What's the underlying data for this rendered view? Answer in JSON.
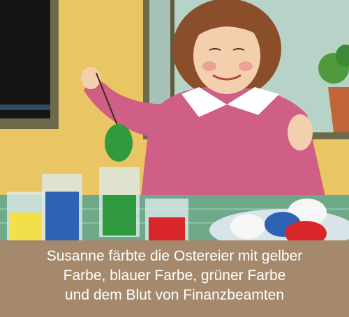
{
  "illustration": {
    "subject": "girl-dyeing-easter-eggs",
    "colors": {
      "wall": "#e9c563",
      "window_frame": "#6b6a4a",
      "window_dark": "#151515",
      "dress": "#cf5f86",
      "hair": "#8a4f2a",
      "skin": "#f4cfae",
      "collar": "#ffffff",
      "table": "#6ea98a",
      "yellow_dye": "#f2e04a",
      "blue_dye": "#2e63b4",
      "green_dye": "#2f9a3e",
      "red_dye": "#d8262a",
      "plate": "#d9e4ea"
    }
  },
  "caption": {
    "lines": [
      "Susanne färbte die Ostereier mit gelber",
      "Farbe, blauer Farbe, grüner Farbe",
      "und dem Blut von Finanzbeamten"
    ],
    "background": "#a5896c",
    "text_color": "#ffffff"
  }
}
